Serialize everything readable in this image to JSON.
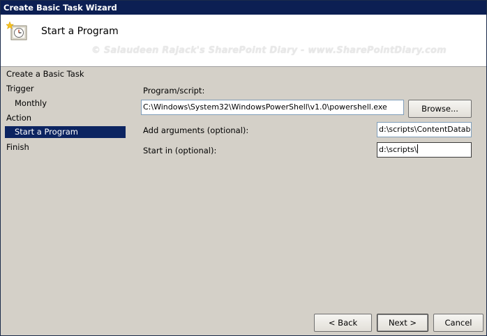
{
  "window": {
    "title": "Create Basic Task Wizard"
  },
  "header": {
    "title": "Start a Program",
    "icon": "task-scheduler-clock-icon",
    "watermark": "© Salaudeen Rajack's SharePoint Diary - www.SharePointDiary.com"
  },
  "nav": {
    "items": [
      {
        "label": "Create a Basic Task",
        "selected": false
      },
      {
        "label": "Trigger",
        "selected": false
      },
      {
        "label": "Monthly",
        "selected": false
      },
      {
        "label": "Action",
        "selected": false
      },
      {
        "label": "Start a Program",
        "selected": true
      },
      {
        "label": "Finish",
        "selected": false
      }
    ]
  },
  "form": {
    "program_label": "Program/script:",
    "program_value": "C:\\Windows\\System32\\WindowsPowerShell\\v1.0\\powershell.exe",
    "browse_label": "Browse...",
    "arguments_label": "Add arguments (optional):",
    "arguments_value": "d:\\scripts\\ContentDatab",
    "startin_label": "Start in (optional):",
    "startin_value": "d:\\scripts\\"
  },
  "buttons": {
    "back": "< Back",
    "next": "Next >",
    "cancel": "Cancel"
  },
  "colors": {
    "titlebar": "#0c1f53",
    "selection": "#0c2461",
    "face": "#d4d0c8"
  }
}
